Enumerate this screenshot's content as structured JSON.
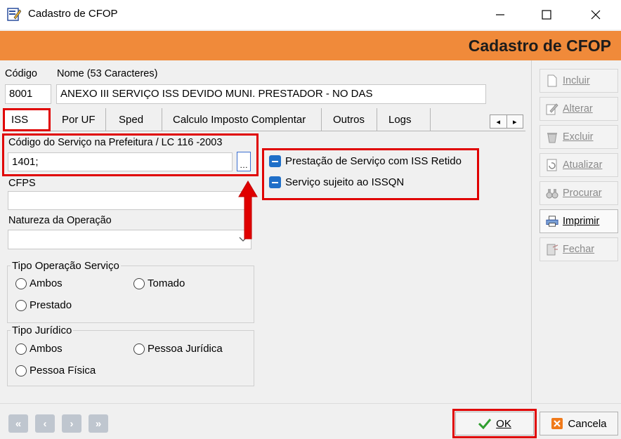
{
  "window": {
    "title": "Cadastro de CFOP",
    "minimize_glyph": "—",
    "maximize_glyph": "☐",
    "close_glyph": "✕"
  },
  "banner": {
    "title": "Cadastro de CFOP"
  },
  "form": {
    "codigo_label": "Código",
    "codigo_value": "8001",
    "nome_label": "Nome (53 Caracteres)",
    "nome_value": "ANEXO III SERVIÇO ISS DEVIDO MUNI. PRESTADOR - NO DAS"
  },
  "tabs": [
    {
      "label": "ISS",
      "selected": true
    },
    {
      "label": "Por UF"
    },
    {
      "label": "Sped"
    },
    {
      "label": "Calculo Imposto Complentar"
    },
    {
      "label": "Outros"
    },
    {
      "label": "Logs"
    }
  ],
  "tab_scroll": {
    "left": "◂",
    "right": "▸"
  },
  "iss": {
    "codigo_servico_label": "Código do Serviço na Prefeitura / LC 116 -2003",
    "codigo_servico_value": "1401;",
    "lookup_glyph": "…",
    "cfps_label": "CFPS",
    "cfps_value": "",
    "natureza_label": "Natureza da Operação",
    "natureza_value": "",
    "checkboxes": [
      {
        "label": "Prestação de Serviço com ISS Retido",
        "state": "indeterminate"
      },
      {
        "label": "Serviço sujeito ao ISSQN",
        "state": "indeterminate"
      }
    ],
    "tipo_operacao": {
      "legend": "Tipo Operação Serviço",
      "options": [
        "Ambos",
        "Tomado",
        "Prestado"
      ]
    },
    "tipo_juridico": {
      "legend": "Tipo Jurídico",
      "options": [
        "Ambos",
        "Pessoa Jurídica",
        "Pessoa Física"
      ]
    }
  },
  "sidebar": {
    "buttons": [
      {
        "label": "Incluir",
        "icon": "new-document-icon",
        "enabled": false
      },
      {
        "label": "Alterar",
        "icon": "edit-icon",
        "enabled": false
      },
      {
        "label": "Excluir",
        "icon": "delete-icon",
        "enabled": false
      },
      {
        "label": "Atualizar",
        "icon": "refresh-icon",
        "enabled": false
      },
      {
        "label": "Procurar",
        "icon": "binoculars-icon",
        "enabled": false
      },
      {
        "label": "Imprimir",
        "icon": "printer-icon",
        "enabled": true
      },
      {
        "label": "Fechar",
        "icon": "close-door-icon",
        "enabled": false
      }
    ]
  },
  "bottom": {
    "nav": [
      "«",
      "‹",
      "›",
      "»"
    ],
    "ok_label": "OK",
    "cancel_label": "Cancela"
  },
  "colors": {
    "banner": "#f08a3a",
    "highlight": "#e00000",
    "checkbox": "#1f6fc8",
    "ok_check": "#2f9e2f",
    "cancel_icon": "#f07a1a"
  }
}
